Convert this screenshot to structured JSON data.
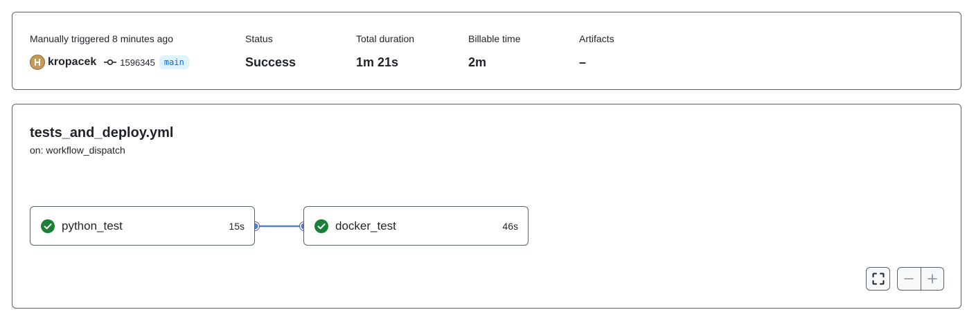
{
  "summary": {
    "trigger_label": "Manually triggered 8 minutes ago",
    "actor": "kropacek",
    "commit_sha": "1596345",
    "branch": "main",
    "status_label": "Status",
    "status_value": "Success",
    "duration_label": "Total duration",
    "duration_value": "1m 21s",
    "billable_label": "Billable time",
    "billable_value": "2m",
    "artifacts_label": "Artifacts",
    "artifacts_value": "–"
  },
  "workflow": {
    "file": "tests_and_deploy.yml",
    "trigger": "on: workflow_dispatch",
    "jobs": [
      {
        "name": "python_test",
        "duration": "15s",
        "status": "success"
      },
      {
        "name": "docker_test",
        "duration": "46s",
        "status": "success"
      }
    ]
  },
  "controls": {
    "fullscreen_icon": "fullscreen-icon",
    "zoom_out_icon": "minus-icon",
    "zoom_in_icon": "plus-icon"
  },
  "colors": {
    "success": "#1a7f37",
    "connector": "#4f80d4",
    "branch_bg": "#ddf4ff",
    "branch_fg": "#0969da"
  }
}
